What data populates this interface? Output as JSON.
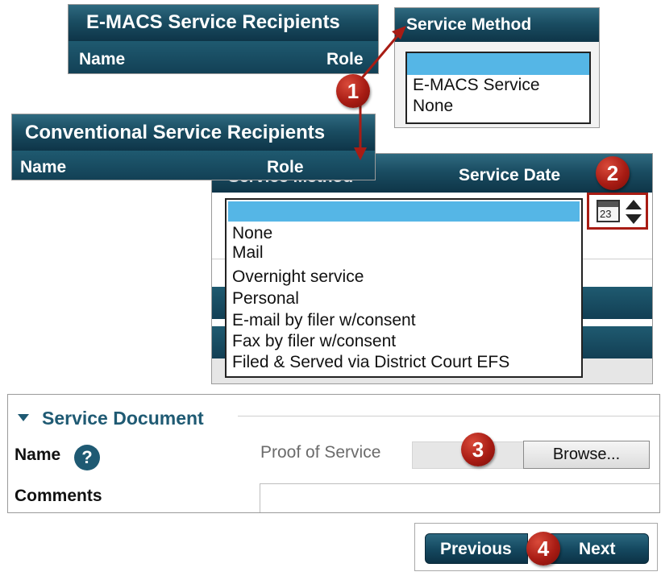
{
  "emacs_panel": {
    "title": "E-MACS Service Recipients",
    "col_name": "Name",
    "col_role": "Role"
  },
  "service_method_panel": {
    "title": "Service Method",
    "options": [
      "",
      "E-MACS Service",
      "None"
    ]
  },
  "conventional_panel": {
    "title": "Conventional Service Recipients",
    "col_name": "Name",
    "col_role": "Role"
  },
  "conventional_method_panel": {
    "col_method": "Service Method",
    "col_date": "Service Date",
    "calendar_day": "23",
    "options": [
      "",
      "None",
      "Mail",
      "Overnight service",
      "Personal",
      "E-mail by filer w/consent",
      "Fax by filer w/consent",
      "Filed & Served via District Court EFS"
    ]
  },
  "service_document": {
    "section_title": "Service Document",
    "name_label": "Name",
    "help_glyph": "?",
    "file_placeholder": "Proof of Service",
    "browse_label": "Browse...",
    "comments_label": "Comments"
  },
  "nav": {
    "previous_label": "Previous",
    "next_label": "Next"
  },
  "badges": [
    "1",
    "2",
    "3",
    "4"
  ],
  "colors": {
    "header_dark": "#1a4d62",
    "selected_option": "#55b6e6",
    "badge_red": "#a81c14",
    "highlight_box": "#a81c14",
    "section_title": "#1f5a73"
  }
}
